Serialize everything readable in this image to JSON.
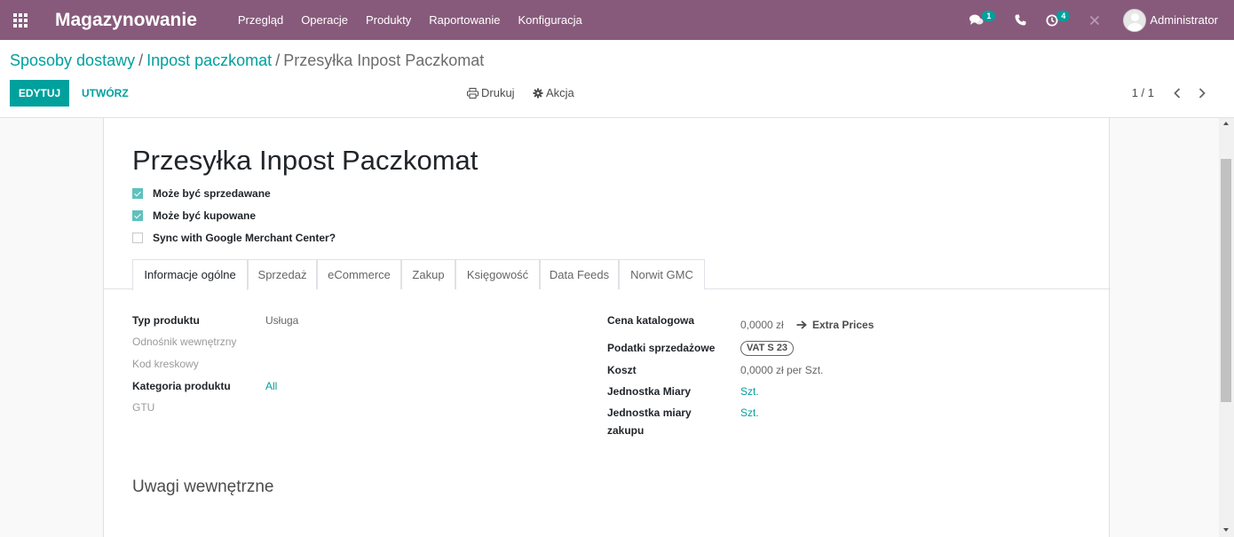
{
  "colors": {
    "brand": "#875a7b",
    "accent": "#00a09d"
  },
  "navbar": {
    "apps_icon": "grid-icon",
    "app_name": "Magazynowanie",
    "menu": [
      "Przegląd",
      "Operacje",
      "Produkty",
      "Raportowanie",
      "Konfiguracja"
    ],
    "messages_badge": "1",
    "activities_badge": "4",
    "user_name": "Administrator"
  },
  "breadcrumb": {
    "items": [
      "Sposoby dostawy",
      "Inpost paczkomat"
    ],
    "separator": "/",
    "current": "Przesyłka Inpost Paczkomat"
  },
  "control": {
    "edit_label": "EDYTUJ",
    "create_label": "UTWÓRZ",
    "print_label": "Drukuj",
    "action_label": "Akcja",
    "pager": "1 / 1"
  },
  "product": {
    "name": "Przesyłka Inpost Paczkomat",
    "options": [
      {
        "label": "Może być sprzedawane",
        "checked": true
      },
      {
        "label": "Może być kupowane",
        "checked": true
      },
      {
        "label": "Sync with Google Merchant Center?",
        "checked": false
      }
    ]
  },
  "tabs": [
    "Informacje ogólne",
    "Sprzedaż",
    "eCommerce",
    "Zakup",
    "Księgowość",
    "Data Feeds",
    "Norwit GMC"
  ],
  "active_tab": 0,
  "left_fields": {
    "product_type": {
      "label": "Typ produktu",
      "value": "Usługa"
    },
    "internal_ref": {
      "label": "Odnośnik wewnętrzny"
    },
    "barcode": {
      "label": "Kod kreskowy"
    },
    "category": {
      "label": "Kategoria produktu",
      "value": "All"
    },
    "gtu": {
      "label": "GTU"
    }
  },
  "right_fields": {
    "list_price": {
      "label": "Cena katalogowa",
      "value": "0,0000 zł",
      "extra": "Extra Prices"
    },
    "taxes": {
      "label": "Podatki sprzedażowe",
      "value": "VAT S 23"
    },
    "cost": {
      "label": "Koszt",
      "value": "0,0000 zł per Szt."
    },
    "uom": {
      "label": "Jednostka Miary",
      "value": "Szt."
    },
    "purchase_uom": {
      "label_line1": "Jednostka miary",
      "label_line2": "zakupu",
      "value": "Szt."
    }
  },
  "notes_title": "Uwagi wewnętrzne"
}
